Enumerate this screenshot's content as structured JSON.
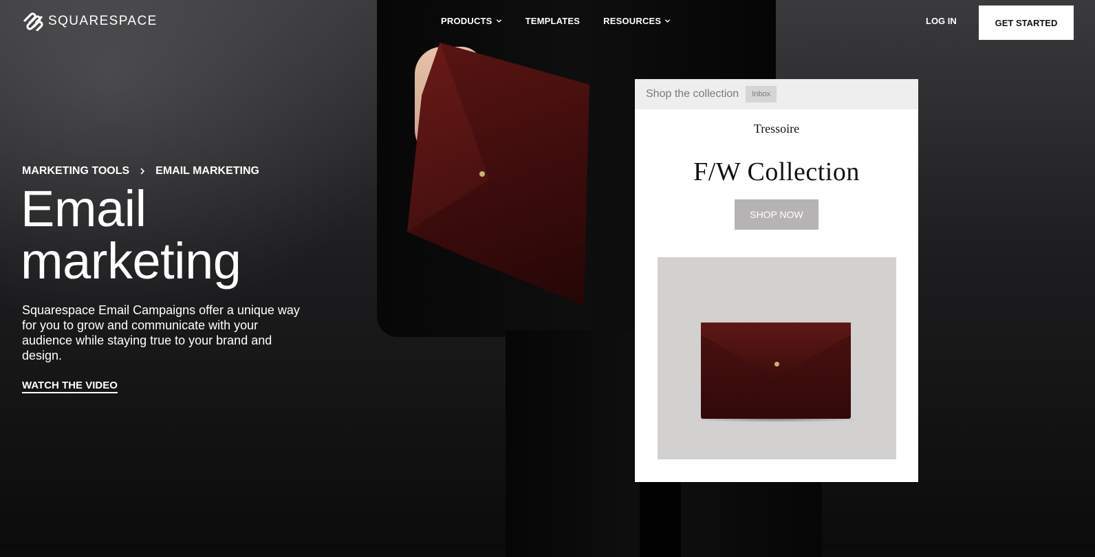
{
  "nav": {
    "logo_text": "SQUARESPACE",
    "items": [
      {
        "label": "PRODUCTS",
        "has_dropdown": true
      },
      {
        "label": "TEMPLATES",
        "has_dropdown": false
      },
      {
        "label": "RESOURCES",
        "has_dropdown": true
      }
    ],
    "login_label": "LOG IN",
    "cta_label": "GET STARTED"
  },
  "hero": {
    "breadcrumb": [
      "MARKETING TOOLS",
      "EMAIL MARKETING"
    ],
    "title_line1": "Email",
    "title_line2": "marketing",
    "description": "Squarespace Email Campaigns offer a unique way for you to grow and communicate with your audience while staying true to your brand and design.",
    "video_link": "WATCH THE VIDEO"
  },
  "email_preview": {
    "subject": "Shop the collection",
    "tag": "Inbox",
    "brand": "Tressoire",
    "headline": "F/W Collection",
    "button_label": "SHOP NOW"
  },
  "colors": {
    "background": "#0d0d0e",
    "cta_background": "#ffffff",
    "email_header_bg": "#efeeee",
    "shop_button_bg": "#b5b3b3",
    "product_bg": "#d3d0d0",
    "leather": "#4a1211"
  },
  "icons": [
    "squarespace-logo-icon",
    "chevron-down-icon",
    "chevron-right-icon"
  ]
}
